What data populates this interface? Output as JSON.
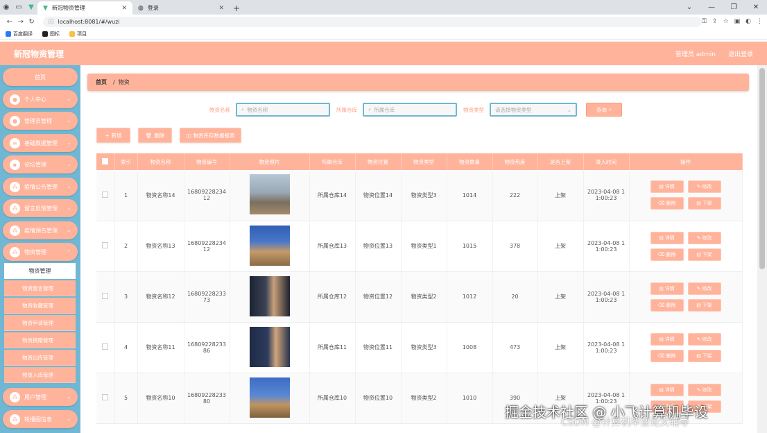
{
  "browser": {
    "tabs": [
      {
        "label": "新冠物资管理",
        "active": true
      },
      {
        "label": "登录",
        "active": false
      }
    ],
    "url": "localhost:8081/#/wuzi",
    "bookmarks": [
      "百度翻译",
      "图标",
      "项目"
    ]
  },
  "header": {
    "title": "新冠物资管理",
    "user": "管理员 admin",
    "logout": "退出登录"
  },
  "sidebar": {
    "home": "首页",
    "menus": [
      "个人中心",
      "管理员管理",
      "基础数据管理",
      "论坛管理",
      "疫情公告管理",
      "留言反馈管理",
      "疫情预告管理",
      "物资管理"
    ],
    "submenus_active": "物资管理",
    "submenus": [
      "物资留言管理",
      "物资收藏管理",
      "物资申请管理",
      "物资捐赠管理",
      "物资出库管理",
      "物资入库管理"
    ],
    "menus_after": [
      "用户管理",
      "轮播图信息"
    ]
  },
  "breadcrumb": {
    "home": "首页",
    "sep": "/",
    "current": "物资"
  },
  "filters": {
    "name_label": "物资名称",
    "name_placeholder": "物资名称",
    "warehouse_label": "所属仓库",
    "warehouse_placeholder": "所属仓库",
    "type_label": "物资类型",
    "type_placeholder": "请选择物资类型",
    "search": "查询"
  },
  "actions": {
    "add": "新增",
    "delete": "删除",
    "report": "物资库存数据报表"
  },
  "table": {
    "headers": [
      "索引",
      "物资名称",
      "物资编号",
      "物资照片",
      "所属仓库",
      "物资位置",
      "物资类型",
      "物资数量",
      "物资热度",
      "是否上架",
      "录入时间",
      "操作"
    ],
    "rows": [
      {
        "index": "1",
        "name": "物资名称14",
        "code": "16809228234\n12",
        "warehouse": "所属仓库14",
        "location": "物资位置14",
        "type": "物资类型3",
        "qty": "1014",
        "heat": "222",
        "status": "上架",
        "time": "2023-04-08 1\n1:00:23"
      },
      {
        "index": "2",
        "name": "物资名称13",
        "code": "16809228234\n12",
        "warehouse": "所属仓库13",
        "location": "物资位置13",
        "type": "物资类型1",
        "qty": "1015",
        "heat": "378",
        "status": "上架",
        "time": "2023-04-08 1\n1:00:23"
      },
      {
        "index": "3",
        "name": "物资名称12",
        "code": "16809228233\n73",
        "warehouse": "所属仓库12",
        "location": "物资位置12",
        "type": "物资类型2",
        "qty": "1012",
        "heat": "20",
        "status": "上架",
        "time": "2023-04-08 1\n1:00:23"
      },
      {
        "index": "4",
        "name": "物资名称11",
        "code": "16809228233\n86",
        "warehouse": "所属仓库11",
        "location": "物资位置11",
        "type": "物资类型3",
        "qty": "1008",
        "heat": "473",
        "status": "上架",
        "time": "2023-04-08 1\n1:00:23"
      },
      {
        "index": "5",
        "name": "物资名称10",
        "code": "16809228233\n80",
        "warehouse": "所属仓库10",
        "location": "物资位置10",
        "type": "物资类型2",
        "qty": "1010",
        "heat": "390",
        "status": "上架",
        "time": "2023-04-08 1\n1:00:23"
      }
    ],
    "ops": {
      "detail": "详情",
      "edit": "修改",
      "delete": "删除",
      "offshelf": "下架"
    }
  },
  "watermark": {
    "line1": "掘金技术社区 @ 小飞计算机毕设",
    "line2": "CSDN @计算机毕业论文辅导"
  }
}
